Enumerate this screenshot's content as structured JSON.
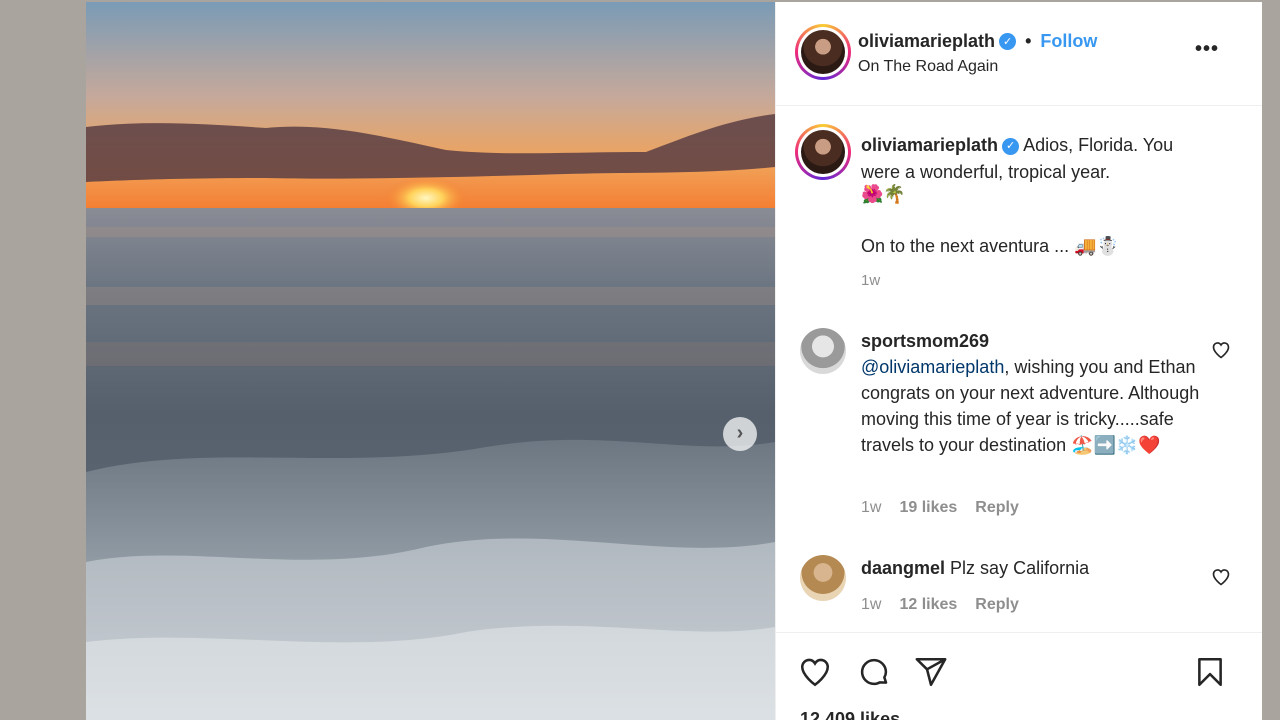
{
  "post": {
    "author": {
      "username": "oliviamarieplath",
      "verified_icon": "verified-badge-icon",
      "follow_label": "Follow",
      "separator": "•",
      "location": "On The Road Again"
    },
    "more_label": "•••",
    "next_arrow": "›",
    "caption": {
      "username": "oliviamarieplath",
      "text": "Adios, Florida. You were a wonderful, tropical year.",
      "emoji_line": "🌺🌴",
      "line2": "On to the next aventura ... 🚚☃️",
      "time": "1w"
    },
    "comments": [
      {
        "username": "sportsmom269",
        "mention": "@oliviamarieplath",
        "text": ", wishing you and Ethan congrats on your next adventure. Although moving this time of year is tricky.....safe travels to your destination 🏖️➡️❄️❤️",
        "time": "1w",
        "likes": "19 likes",
        "reply_label": "Reply"
      },
      {
        "username": "daangmel",
        "text": "Plz say California",
        "time": "1w",
        "likes": "12 likes",
        "reply_label": "Reply"
      }
    ],
    "likes_count": "12,409 likes"
  },
  "colors": {
    "link_blue": "#3897f0",
    "muted": "#8e8e8e",
    "background": "#aaa49e"
  }
}
